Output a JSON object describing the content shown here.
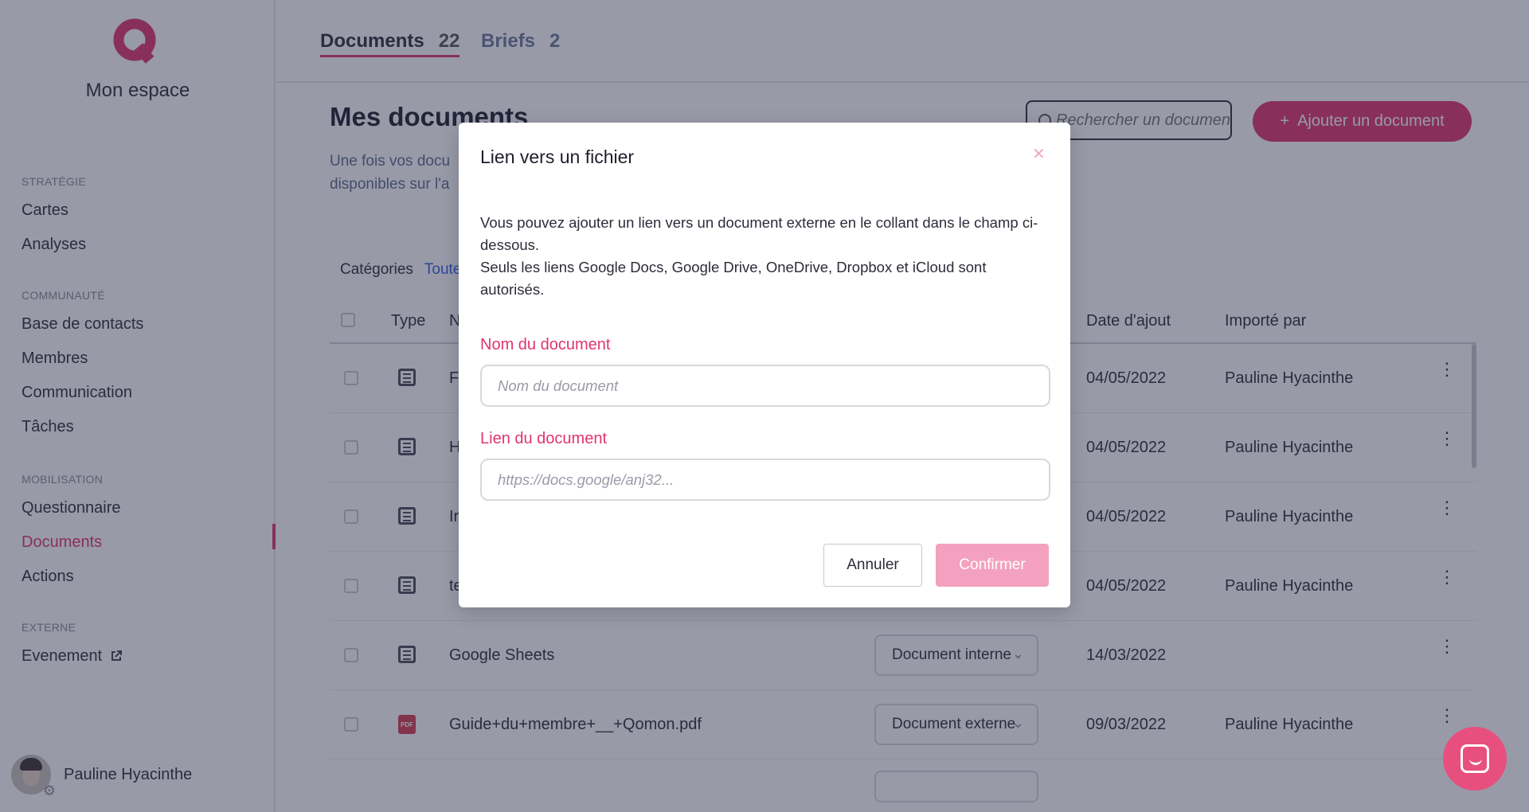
{
  "sidebar": {
    "title": "Mon espace",
    "sections": [
      {
        "heading": "STRATÉGIE",
        "items": [
          "Cartes",
          "Analyses"
        ]
      },
      {
        "heading": "COMMUNAUTÉ",
        "items": [
          "Base de contacts",
          "Membres",
          "Communication",
          "Tâches"
        ]
      },
      {
        "heading": "MOBILISATION",
        "items": [
          "Questionnaire",
          "Documents",
          "Actions"
        ]
      },
      {
        "heading": "EXTERNE",
        "items": [
          "Evenement"
        ]
      }
    ],
    "active_item": "Documents",
    "user_name": "Pauline Hyacinthe"
  },
  "tabs": [
    {
      "label": "Documents",
      "count": "22"
    },
    {
      "label": "Briefs",
      "count": "2"
    }
  ],
  "main": {
    "title": "Mes documents",
    "description_line1": "Une fois vos docu",
    "description_line2": "disponibles sur l'a",
    "search_placeholder": "Rechercher un document",
    "add_button_label": "Ajouter un document",
    "add_button_plus": "+",
    "categories_label": "Catégories",
    "categories_link": "Toute"
  },
  "table": {
    "headers": {
      "type": "Type",
      "name": "N",
      "date": "Date d'ajout",
      "imported_by": "Importé par"
    },
    "rows": [
      {
        "name": "F",
        "type_select": "",
        "date": "04/05/2022",
        "imported_by": "Pauline Hyacinthe",
        "icon": "doc"
      },
      {
        "name": "H",
        "type_select": "",
        "date": "04/05/2022",
        "imported_by": "Pauline Hyacinthe",
        "icon": "doc"
      },
      {
        "name": "Ir",
        "type_select": "",
        "date": "04/05/2022",
        "imported_by": "Pauline Hyacinthe",
        "icon": "doc"
      },
      {
        "name": "te",
        "type_select": "",
        "date": "04/05/2022",
        "imported_by": "Pauline Hyacinthe",
        "icon": "doc"
      },
      {
        "name": "Google Sheets",
        "type_select": "Document interne",
        "date": "14/03/2022",
        "imported_by": "",
        "icon": "doc"
      },
      {
        "name": "Guide+du+membre+__+Qomon.pdf",
        "type_select": "Document externe",
        "date": "09/03/2022",
        "imported_by": "Pauline Hyacinthe",
        "icon": "pdf"
      }
    ],
    "pdf_icon_text": "PDF"
  },
  "modal": {
    "title": "Lien vers un fichier",
    "close_glyph": "✕",
    "text_line1": "Vous pouvez ajouter un lien vers un document externe en le collant dans le champ ci-dessous.",
    "text_line2": "Seuls les liens Google Docs, Google Drive, OneDrive, Dropbox et iCloud sont autorisés.",
    "name_label": "Nom du document",
    "name_placeholder": "Nom du document",
    "name_value": "",
    "link_label": "Lien du document",
    "link_placeholder": "https://docs.google/anj32...",
    "link_value": "",
    "cancel_label": "Annuler",
    "confirm_label": "Confirmer"
  },
  "colors": {
    "accent": "#e0356e",
    "accent_light": "#f4a1bf",
    "link": "#2f5fe0",
    "overlay": "rgba(40,44,72,0.48)"
  },
  "icons": {
    "logo": "qomon-logo-icon",
    "external_link": "external-link-icon",
    "search": "search-icon",
    "chat": "chat-icon",
    "settings": "gear-icon",
    "kebab": "kebab-menu-icon",
    "chevron": "chevron-down-icon"
  }
}
